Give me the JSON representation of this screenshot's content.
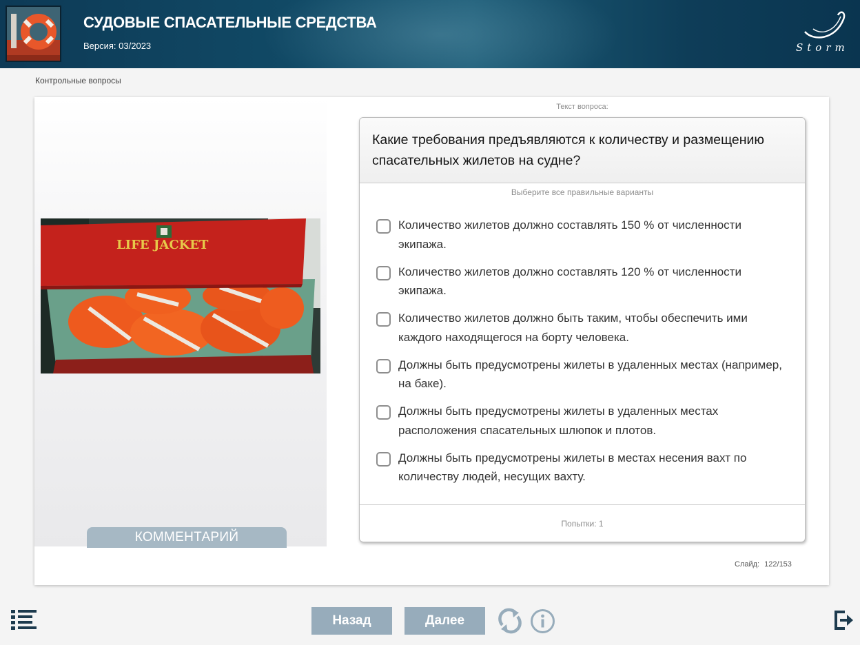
{
  "header": {
    "title": "СУДОВЫЕ СПАСАТЕЛЬНЫЕ СРЕДСТВА",
    "version": "Версия: 03/2023",
    "brand": "Storm"
  },
  "breadcrumb": "Контрольные вопросы",
  "left_panel": {
    "photo_caption": "LIFE JACKET",
    "comment_label": "КОММЕНТАРИЙ"
  },
  "question": {
    "caption": "Текст вопроса:",
    "text": "Какие требования предъявляются к количеству и размещению спасательных жилетов на судне?",
    "hint": "Выберите все правильные варианты",
    "options": [
      {
        "label": "Количество жилетов должно составлять 150 % от численности экипажа.",
        "checked": false
      },
      {
        "label": "Количество жилетов должно составлять 120 % от численности экипажа.",
        "checked": false
      },
      {
        "label": "Количество жилетов должно быть таким, чтобы обеспечить ими каждого находящегося на борту человека.",
        "checked": false
      },
      {
        "label": "Должны быть предусмотрены жилеты в удаленных местах (например, на баке).",
        "checked": false
      },
      {
        "label": "Должны быть предусмотрены жилеты в удаленных местах расположения спасательных шлюпок и плотов.",
        "checked": false
      },
      {
        "label": "Должны быть предусмотрены жилеты в местах несения вахт по количеству людей, несущих вахту.",
        "checked": false
      }
    ],
    "attempts": "Попытки: 1"
  },
  "slide_counter": "Слайд: 122/153",
  "nav": {
    "back_label": "Назад",
    "next_label": "Далее"
  },
  "colors": {
    "header_dark": "#0d3a56",
    "nav_button": "#97acbb",
    "comment_tab": "#a6b8c4",
    "icon_dark": "#1d3b4e"
  },
  "icons": [
    "menu-icon",
    "reload-icon",
    "info-icon",
    "exit-icon"
  ]
}
